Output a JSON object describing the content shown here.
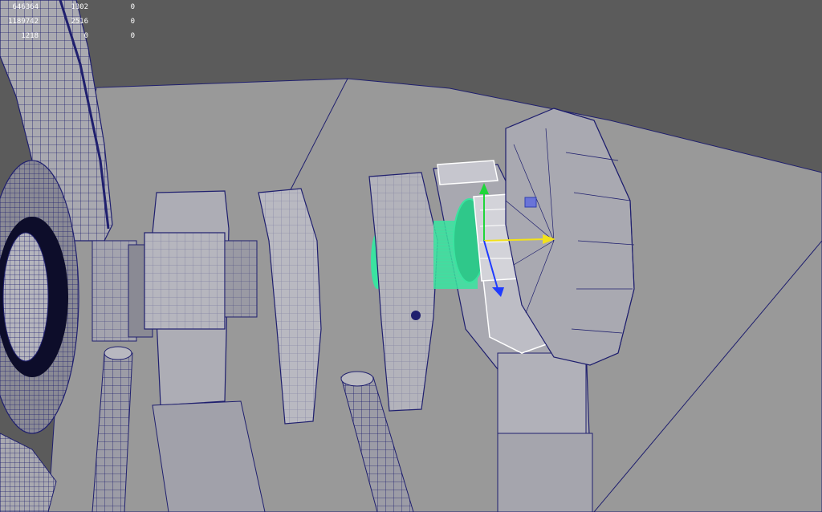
{
  "viewport": {
    "background_color": "#5b5b5b",
    "floor_color": "#9a9a9a",
    "wire_color": "#1f1f6e",
    "selection_color": "#ffffff",
    "highlight_color": "#3be3a0",
    "gizmo": {
      "x_axis_color": "#f2e11a",
      "y_axis_color": "#1fd63a",
      "z_axis_color": "#1f3bff"
    }
  },
  "hud_stats": {
    "rows": [
      [
        "646364",
        "1302",
        "0"
      ],
      [
        "1189742",
        "2516",
        "0"
      ],
      [
        "1218",
        "0",
        "0"
      ]
    ]
  }
}
